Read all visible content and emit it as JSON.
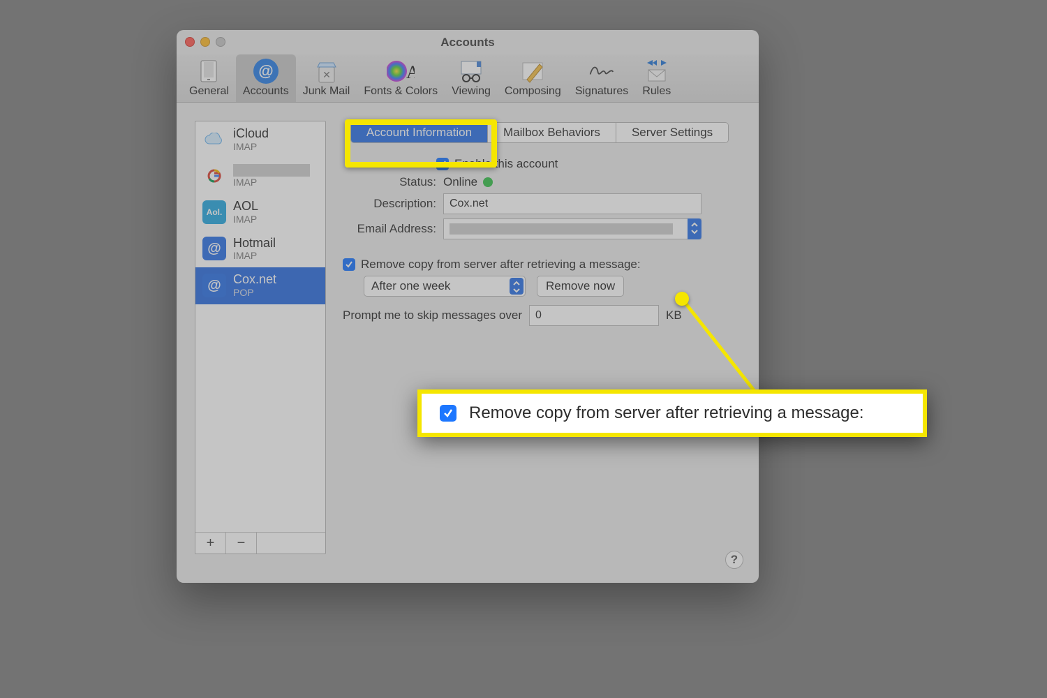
{
  "window": {
    "title": "Accounts"
  },
  "toolbar": [
    {
      "label": "General"
    },
    {
      "label": "Accounts",
      "selected": true
    },
    {
      "label": "Junk Mail"
    },
    {
      "label": "Fonts & Colors"
    },
    {
      "label": "Viewing"
    },
    {
      "label": "Composing"
    },
    {
      "label": "Signatures"
    },
    {
      "label": "Rules"
    }
  ],
  "accounts": [
    {
      "name": "iCloud",
      "protocol": "IMAP",
      "iconBg": "#ffffff",
      "iconKind": "cloud"
    },
    {
      "name": "",
      "protocol": "IMAP",
      "iconBg": "#ffffff",
      "iconKind": "google",
      "redacted": true
    },
    {
      "name": "AOL",
      "protocol": "IMAP",
      "iconBg": "#2aa9e0",
      "iconText": "Aol."
    },
    {
      "name": "Hotmail",
      "protocol": "IMAP",
      "iconBg": "#2f73e6",
      "iconText": "@"
    },
    {
      "name": "Cox.net",
      "protocol": "POP",
      "iconBg": "#2f73e6",
      "iconText": "@",
      "selected": true
    }
  ],
  "sidefoot": {
    "add": "+",
    "remove": "−"
  },
  "tabs": [
    {
      "label": "Account Information",
      "active": true
    },
    {
      "label": "Mailbox Behaviors"
    },
    {
      "label": "Server Settings"
    }
  ],
  "form": {
    "enable_label": "Enable this account",
    "enable_checked": true,
    "status_label": "Status:",
    "status_value": "Online",
    "description_label": "Description:",
    "description_value": "Cox.net",
    "email_label": "Email Address:",
    "email_value": "",
    "remove_label": "Remove copy from server after retrieving a message:",
    "remove_checked": true,
    "remove_delay": "After one week",
    "remove_now": "Remove now",
    "skip_label": "Prompt me to skip messages over",
    "skip_value": "0",
    "skip_unit": "KB"
  },
  "help": "?",
  "callout_text": "Remove copy from server after retrieving a message:"
}
